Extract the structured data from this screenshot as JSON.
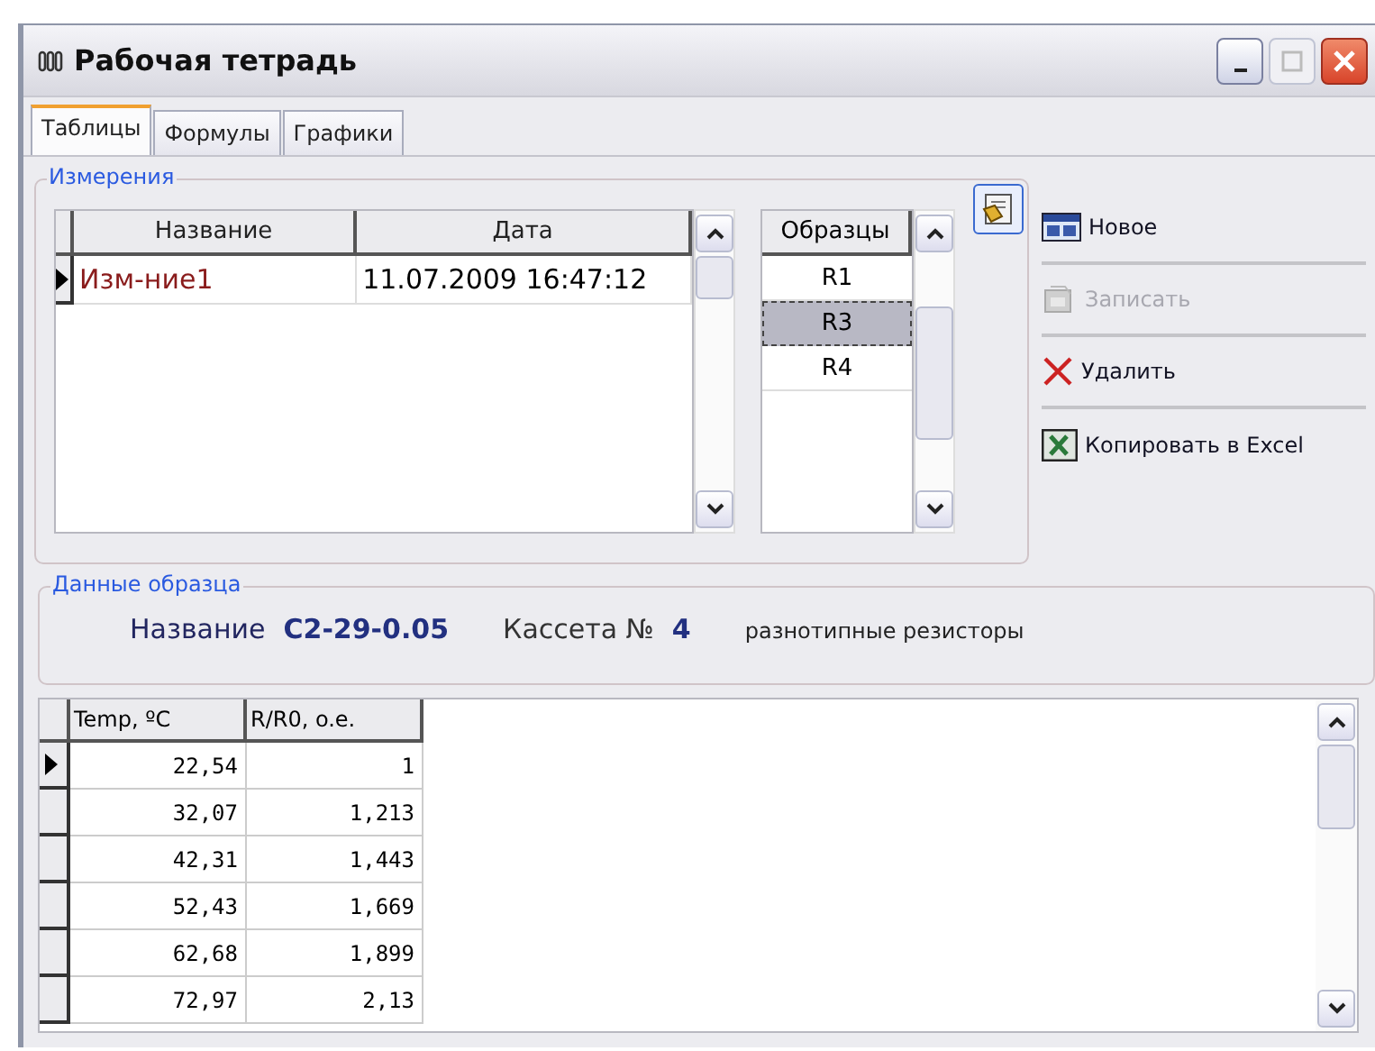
{
  "window": {
    "title": "Рабочая тетрадь"
  },
  "tabs": [
    {
      "label": "Таблицы",
      "selected": true
    },
    {
      "label": "Формулы",
      "selected": false
    },
    {
      "label": "Графики",
      "selected": false
    }
  ],
  "measurements": {
    "label": "Измерения",
    "columns": [
      "Название",
      "Дата"
    ],
    "rows": [
      {
        "cells": [
          "Изм-ние1",
          "11.07.2009 16:47:12"
        ],
        "current": true
      }
    ]
  },
  "samples": {
    "header": "Образцы",
    "items": [
      {
        "label": "R1",
        "selected": false
      },
      {
        "label": "R3",
        "selected": true
      },
      {
        "label": "R4",
        "selected": false
      }
    ]
  },
  "actions": [
    {
      "kind": "new",
      "label": "Новое",
      "disabled": false
    },
    {
      "kind": "save",
      "label": "Записать",
      "disabled": true
    },
    {
      "kind": "delete",
      "label": "Удалить",
      "disabled": false
    },
    {
      "kind": "excel",
      "label": "Копировать в Excel",
      "disabled": false
    }
  ],
  "sample_data": {
    "label": "Данные образца",
    "name_label": "Название",
    "name_value": "С2-29-0.05",
    "cassette_label": "Кассета №",
    "cassette_value": "4",
    "description": "разнотипные резисторы"
  },
  "data_table": {
    "columns": [
      "Temp, ºC",
      "R/R0, o.e."
    ],
    "rows": [
      {
        "cells": [
          "22,54",
          "1"
        ],
        "current": true
      },
      {
        "cells": [
          "32,07",
          "1,213"
        ],
        "current": false
      },
      {
        "cells": [
          "42,31",
          "1,443"
        ],
        "current": false
      },
      {
        "cells": [
          "52,43",
          "1,669"
        ],
        "current": false
      },
      {
        "cells": [
          "62,68",
          "1,899"
        ],
        "current": false
      },
      {
        "cells": [
          "72,97",
          "2,13"
        ],
        "current": false
      }
    ]
  }
}
